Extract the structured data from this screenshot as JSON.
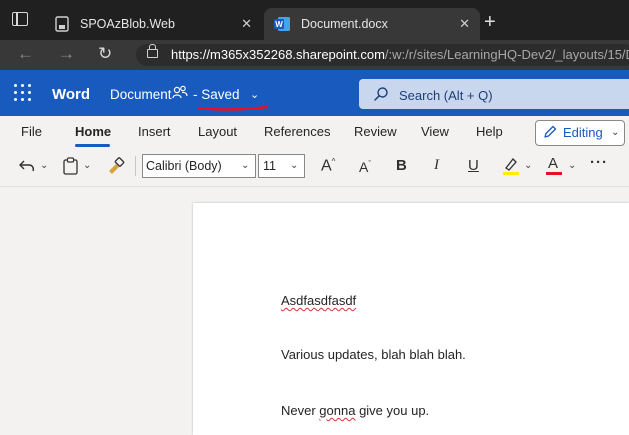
{
  "browser": {
    "tabs": [
      {
        "title": "SPOAzBlob.Web",
        "close": "✕"
      },
      {
        "title": "Document.docx",
        "close": "✕"
      }
    ],
    "new_tab": "+",
    "url_host": "https://m365x352268.sharepoint.com",
    "url_path": "/:w:/r/sites/LearningHQ-Dev2/_layouts/15/D"
  },
  "word": {
    "app_name": "Word",
    "doc_name": "Document",
    "save_status": "- Saved",
    "search_placeholder": "Search (Alt + Q)",
    "menu": [
      "File",
      "Home",
      "Insert",
      "Layout",
      "References",
      "Review",
      "View",
      "Help"
    ],
    "editing_label": "Editing",
    "font_name": "Calibri (Body)",
    "font_size": "11",
    "accent_color": "#185abd"
  },
  "document": {
    "paragraphs": [
      {
        "text": "Asdfasdfasdf"
      },
      {
        "text": "Various updates, blah blah blah."
      },
      {
        "before": "Never ",
        "flagged": "gonna",
        "after": " give you up."
      }
    ]
  }
}
